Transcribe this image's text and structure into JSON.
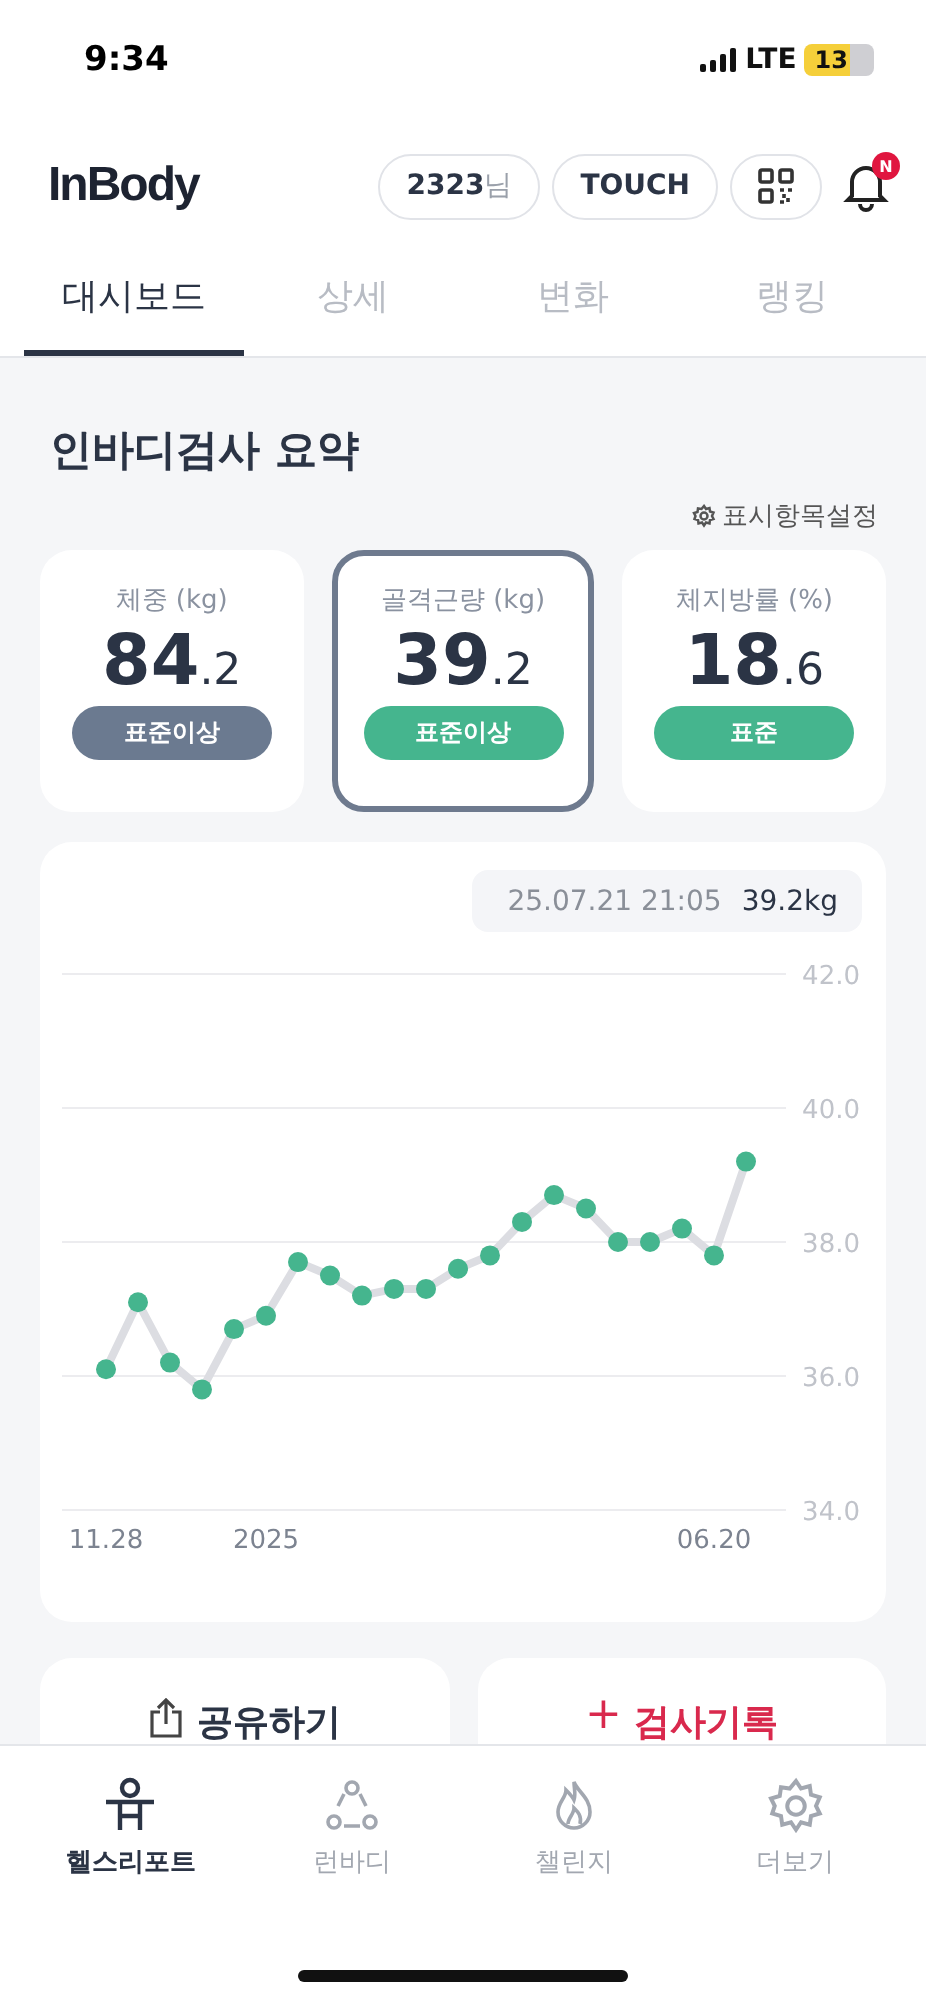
{
  "status_bar": {
    "time": "9:34",
    "network": "LTE",
    "battery": "13"
  },
  "header": {
    "logo": "InBody",
    "user_id": "2323",
    "user_suffix": "님",
    "touch_button": "TOUCH",
    "notification_badge": "N"
  },
  "tabs": [
    {
      "label": "대시보드",
      "selected": true
    },
    {
      "label": "상세",
      "selected": false
    },
    {
      "label": "변화",
      "selected": false
    },
    {
      "label": "랭킹",
      "selected": false
    }
  ],
  "summary": {
    "title": "인바디검사 요약",
    "settings_link": "표시항목설정",
    "metrics": [
      {
        "label": "체중 (kg)",
        "value_int": "84",
        "value_dec": ".2",
        "badge": "표준이상",
        "color": "#6b7a90",
        "selected": false
      },
      {
        "label": "골격근량 (kg)",
        "value_int": "39",
        "value_dec": ".2",
        "badge": "표준이상",
        "color": "#45b58e",
        "selected": true
      },
      {
        "label": "체지방률 (%)",
        "value_int": "18",
        "value_dec": ".6",
        "badge": "표준",
        "color": "#45b58e",
        "selected": false
      }
    ]
  },
  "chart": {
    "tooltip_date": "25.07.21 21:05",
    "tooltip_value": "39.2kg",
    "chart_data": {
      "type": "line",
      "categories": [
        "11.28",
        null,
        null,
        null,
        null,
        "2025",
        null,
        null,
        null,
        null,
        null,
        null,
        null,
        null,
        null,
        null,
        null,
        null,
        null,
        "06.20",
        null
      ],
      "series": [
        {
          "color": "#45b58e",
          "marker": "circle",
          "values": [
            36.1,
            37.1,
            36.2,
            35.8,
            36.7,
            36.9,
            37.7,
            37.5,
            37.2,
            37.3,
            37.3,
            37.6,
            37.8,
            38.3,
            38.7,
            38.5,
            38.0,
            38.0,
            38.2,
            37.8,
            39.2
          ]
        }
      ],
      "ylim": [
        34,
        42
      ],
      "grid": true,
      "yticks": [
        {
          "value": 34,
          "label": "34.0"
        },
        {
          "value": 36,
          "label": "36.0"
        },
        {
          "value": 38,
          "label": "38.0"
        },
        {
          "value": 40,
          "label": "40.0"
        },
        {
          "value": 42,
          "label": "42.0"
        }
      ]
    }
  },
  "actions": {
    "share": "공유하기",
    "add_record": "검사기록",
    "add_symbol": "+"
  },
  "bottom_nav": [
    {
      "label": "헬스리포트",
      "selected": true
    },
    {
      "label": "런바디",
      "selected": false
    },
    {
      "label": "챌린지",
      "selected": false
    },
    {
      "label": "더보기",
      "selected": false
    }
  ]
}
